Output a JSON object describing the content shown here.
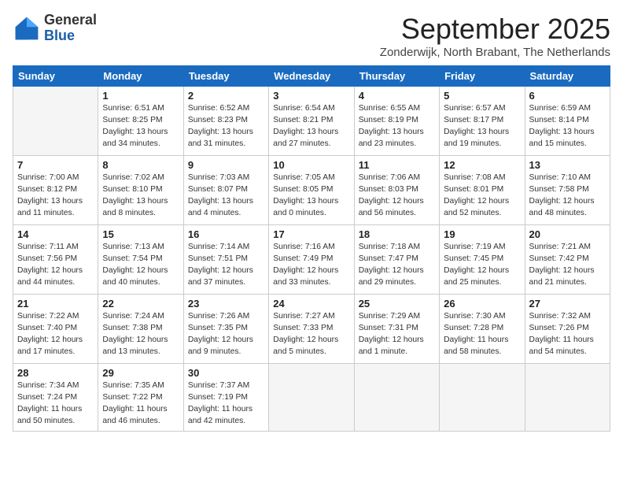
{
  "header": {
    "logo_general": "General",
    "logo_blue": "Blue",
    "month": "September 2025",
    "location": "Zonderwijk, North Brabant, The Netherlands"
  },
  "days_of_week": [
    "Sunday",
    "Monday",
    "Tuesday",
    "Wednesday",
    "Thursday",
    "Friday",
    "Saturday"
  ],
  "weeks": [
    [
      {
        "day": "",
        "info": ""
      },
      {
        "day": "1",
        "info": "Sunrise: 6:51 AM\nSunset: 8:25 PM\nDaylight: 13 hours\nand 34 minutes."
      },
      {
        "day": "2",
        "info": "Sunrise: 6:52 AM\nSunset: 8:23 PM\nDaylight: 13 hours\nand 31 minutes."
      },
      {
        "day": "3",
        "info": "Sunrise: 6:54 AM\nSunset: 8:21 PM\nDaylight: 13 hours\nand 27 minutes."
      },
      {
        "day": "4",
        "info": "Sunrise: 6:55 AM\nSunset: 8:19 PM\nDaylight: 13 hours\nand 23 minutes."
      },
      {
        "day": "5",
        "info": "Sunrise: 6:57 AM\nSunset: 8:17 PM\nDaylight: 13 hours\nand 19 minutes."
      },
      {
        "day": "6",
        "info": "Sunrise: 6:59 AM\nSunset: 8:14 PM\nDaylight: 13 hours\nand 15 minutes."
      }
    ],
    [
      {
        "day": "7",
        "info": "Sunrise: 7:00 AM\nSunset: 8:12 PM\nDaylight: 13 hours\nand 11 minutes."
      },
      {
        "day": "8",
        "info": "Sunrise: 7:02 AM\nSunset: 8:10 PM\nDaylight: 13 hours\nand 8 minutes."
      },
      {
        "day": "9",
        "info": "Sunrise: 7:03 AM\nSunset: 8:07 PM\nDaylight: 13 hours\nand 4 minutes."
      },
      {
        "day": "10",
        "info": "Sunrise: 7:05 AM\nSunset: 8:05 PM\nDaylight: 13 hours\nand 0 minutes."
      },
      {
        "day": "11",
        "info": "Sunrise: 7:06 AM\nSunset: 8:03 PM\nDaylight: 12 hours\nand 56 minutes."
      },
      {
        "day": "12",
        "info": "Sunrise: 7:08 AM\nSunset: 8:01 PM\nDaylight: 12 hours\nand 52 minutes."
      },
      {
        "day": "13",
        "info": "Sunrise: 7:10 AM\nSunset: 7:58 PM\nDaylight: 12 hours\nand 48 minutes."
      }
    ],
    [
      {
        "day": "14",
        "info": "Sunrise: 7:11 AM\nSunset: 7:56 PM\nDaylight: 12 hours\nand 44 minutes."
      },
      {
        "day": "15",
        "info": "Sunrise: 7:13 AM\nSunset: 7:54 PM\nDaylight: 12 hours\nand 40 minutes."
      },
      {
        "day": "16",
        "info": "Sunrise: 7:14 AM\nSunset: 7:51 PM\nDaylight: 12 hours\nand 37 minutes."
      },
      {
        "day": "17",
        "info": "Sunrise: 7:16 AM\nSunset: 7:49 PM\nDaylight: 12 hours\nand 33 minutes."
      },
      {
        "day": "18",
        "info": "Sunrise: 7:18 AM\nSunset: 7:47 PM\nDaylight: 12 hours\nand 29 minutes."
      },
      {
        "day": "19",
        "info": "Sunrise: 7:19 AM\nSunset: 7:45 PM\nDaylight: 12 hours\nand 25 minutes."
      },
      {
        "day": "20",
        "info": "Sunrise: 7:21 AM\nSunset: 7:42 PM\nDaylight: 12 hours\nand 21 minutes."
      }
    ],
    [
      {
        "day": "21",
        "info": "Sunrise: 7:22 AM\nSunset: 7:40 PM\nDaylight: 12 hours\nand 17 minutes."
      },
      {
        "day": "22",
        "info": "Sunrise: 7:24 AM\nSunset: 7:38 PM\nDaylight: 12 hours\nand 13 minutes."
      },
      {
        "day": "23",
        "info": "Sunrise: 7:26 AM\nSunset: 7:35 PM\nDaylight: 12 hours\nand 9 minutes."
      },
      {
        "day": "24",
        "info": "Sunrise: 7:27 AM\nSunset: 7:33 PM\nDaylight: 12 hours\nand 5 minutes."
      },
      {
        "day": "25",
        "info": "Sunrise: 7:29 AM\nSunset: 7:31 PM\nDaylight: 12 hours\nand 1 minute."
      },
      {
        "day": "26",
        "info": "Sunrise: 7:30 AM\nSunset: 7:28 PM\nDaylight: 11 hours\nand 58 minutes."
      },
      {
        "day": "27",
        "info": "Sunrise: 7:32 AM\nSunset: 7:26 PM\nDaylight: 11 hours\nand 54 minutes."
      }
    ],
    [
      {
        "day": "28",
        "info": "Sunrise: 7:34 AM\nSunset: 7:24 PM\nDaylight: 11 hours\nand 50 minutes."
      },
      {
        "day": "29",
        "info": "Sunrise: 7:35 AM\nSunset: 7:22 PM\nDaylight: 11 hours\nand 46 minutes."
      },
      {
        "day": "30",
        "info": "Sunrise: 7:37 AM\nSunset: 7:19 PM\nDaylight: 11 hours\nand 42 minutes."
      },
      {
        "day": "",
        "info": ""
      },
      {
        "day": "",
        "info": ""
      },
      {
        "day": "",
        "info": ""
      },
      {
        "day": "",
        "info": ""
      }
    ]
  ]
}
